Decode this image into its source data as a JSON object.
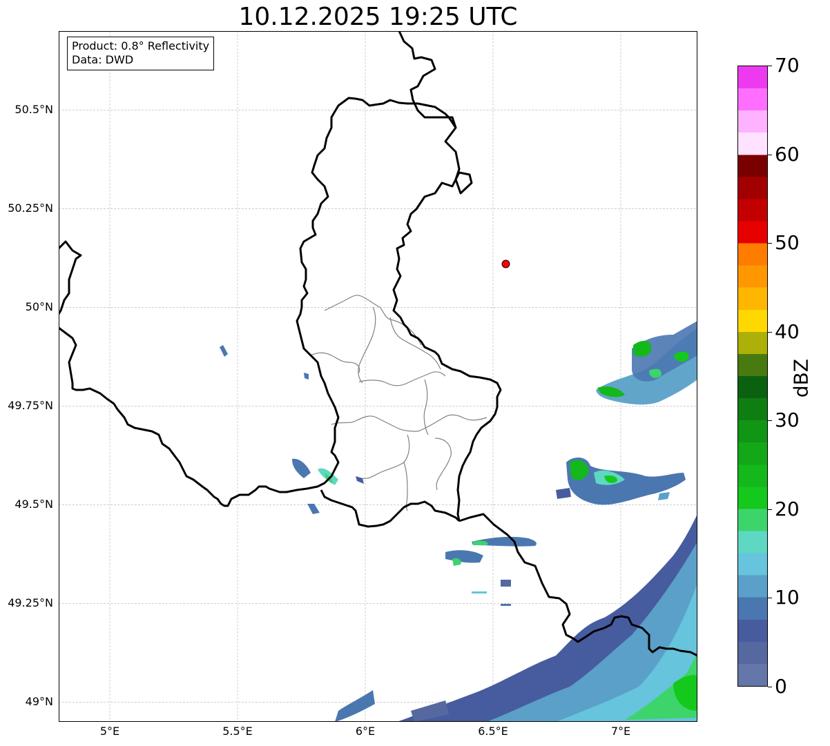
{
  "title": "10.12.2025 19:25 UTC",
  "info_box": {
    "line1": "Product: 0.8° Reflectivity",
    "line2": "Data: DWD"
  },
  "map": {
    "type": "radar-reflectivity-map",
    "lon_range": [
      4.8,
      7.3
    ],
    "lat_range": [
      48.95,
      50.7
    ],
    "lon_ticks": [
      {
        "value": 5.0,
        "label": "5°E"
      },
      {
        "value": 5.5,
        "label": "5.5°E"
      },
      {
        "value": 6.0,
        "label": "6°E"
      },
      {
        "value": 6.5,
        "label": "6.5°E"
      },
      {
        "value": 7.0,
        "label": "7°E"
      }
    ],
    "lat_ticks": [
      {
        "value": 50.5,
        "label": "50.5°N"
      },
      {
        "value": 50.25,
        "label": "50.25°N"
      },
      {
        "value": 50.0,
        "label": "50°N"
      },
      {
        "value": 49.75,
        "label": "49.75°N"
      },
      {
        "value": 49.5,
        "label": "49.5°N"
      },
      {
        "value": 49.25,
        "label": "49.25°N"
      },
      {
        "value": 49.0,
        "label": "49°N"
      }
    ],
    "grid": true,
    "radar_site": {
      "lon": 6.55,
      "lat": 50.11,
      "color": "#ff0000"
    },
    "country_border_color": "#000000",
    "region_border_color": "#808080",
    "echo_areas": [
      {
        "area": "northeast band",
        "lon": 7.15,
        "lat": 49.85,
        "max_dbz": 30
      },
      {
        "area": "east band",
        "lon": 6.95,
        "lat": 49.55,
        "max_dbz": 28
      },
      {
        "area": "southeast sector",
        "lon": 7.0,
        "lat": 49.05,
        "max_dbz": 20
      },
      {
        "area": "west of Luxembourg",
        "lon": 5.85,
        "lat": 49.57,
        "max_dbz": 18
      },
      {
        "area": "south of Luxembourg",
        "lon": 6.55,
        "lat": 49.38,
        "max_dbz": 18
      }
    ]
  },
  "colorbar": {
    "label": "dBZ",
    "min": 0,
    "max": 70,
    "ticks": [
      {
        "value": 0,
        "label": "0"
      },
      {
        "value": 10,
        "label": "10"
      },
      {
        "value": 20,
        "label": "20"
      },
      {
        "value": 30,
        "label": "30"
      },
      {
        "value": 40,
        "label": "40"
      },
      {
        "value": 50,
        "label": "50"
      },
      {
        "value": 60,
        "label": "60"
      },
      {
        "value": 70,
        "label": "70"
      }
    ],
    "colors": [
      "#6577a8",
      "#5569a0",
      "#465c9f",
      "#4b77b0",
      "#5aa0c8",
      "#66c4dc",
      "#5ed8c2",
      "#3dd46c",
      "#14c81c",
      "#14b81a",
      "#12a818",
      "#109514",
      "#0e7e12",
      "#0a6210",
      "#487a10",
      "#acb008",
      "#fed800",
      "#feb600",
      "#ff9800",
      "#fe7c00",
      "#e60000",
      "#c20000",
      "#a20000",
      "#7a0000",
      "#ffe2ff",
      "#ffb2ff",
      "#ff6eff",
      "#ee3aee"
    ]
  }
}
